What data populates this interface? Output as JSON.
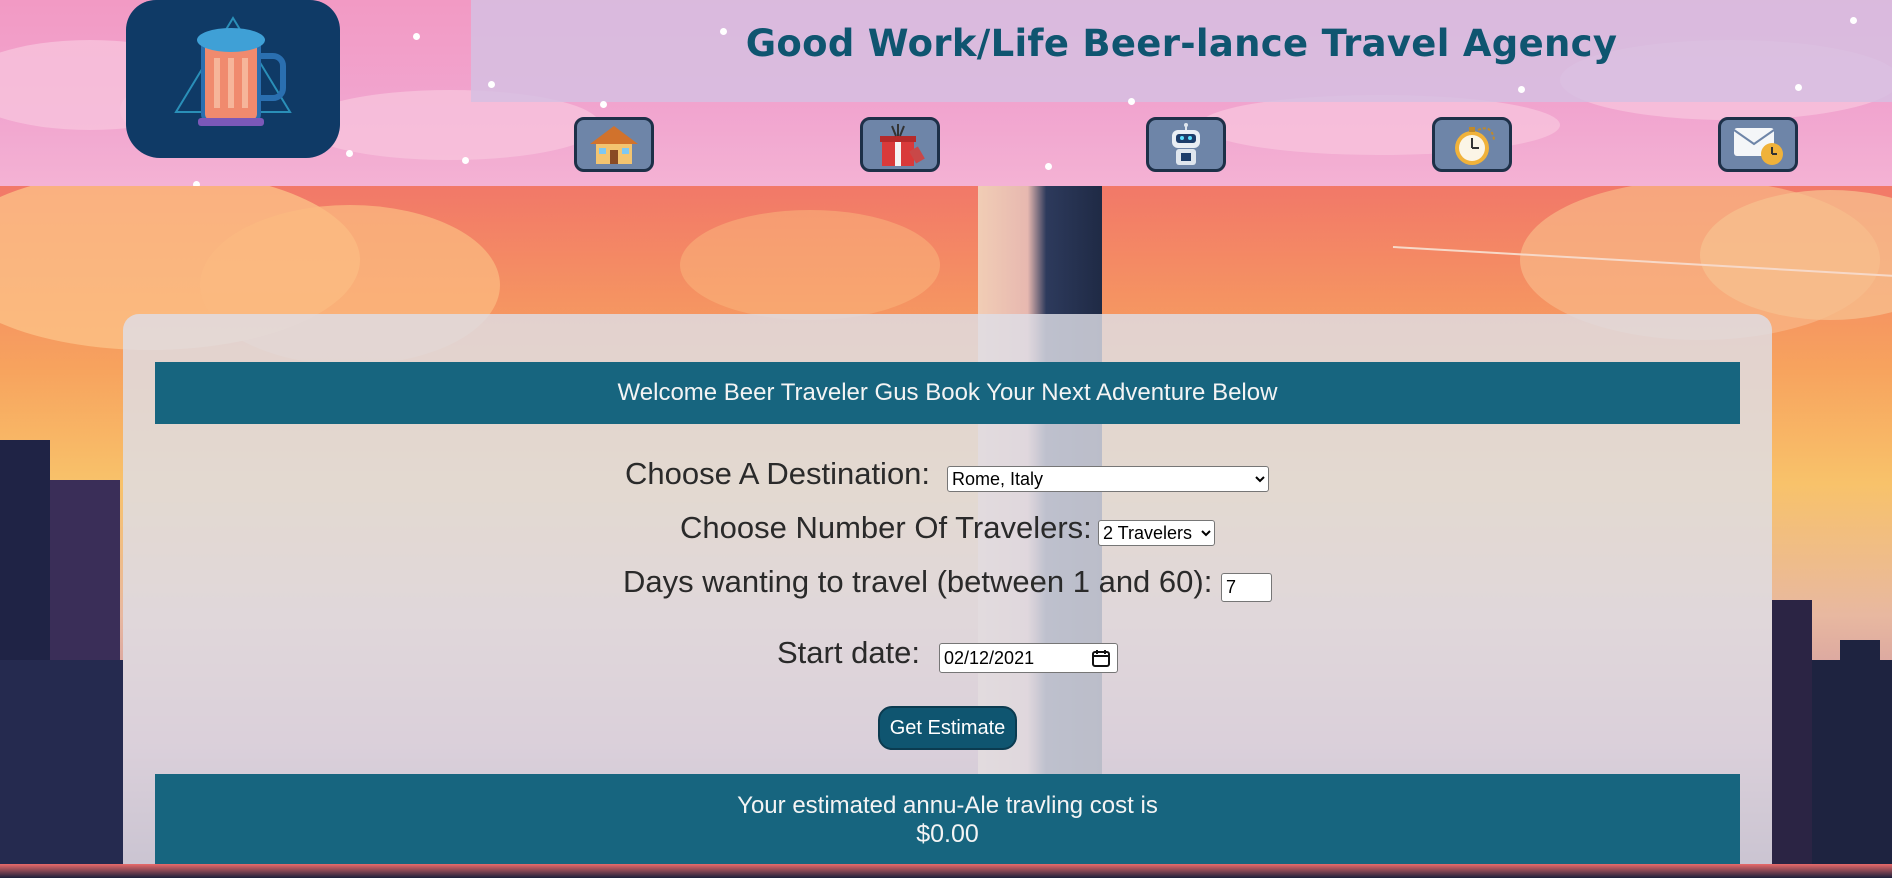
{
  "header": {
    "title": "Good Work/Life Beer-lance Travel Agency",
    "logo_icon": "beer-mug-icon",
    "nav": [
      {
        "icon": "home-icon",
        "label": "Home"
      },
      {
        "icon": "gift-icon",
        "label": "Gifts"
      },
      {
        "icon": "robot-icon",
        "label": "Robot"
      },
      {
        "icon": "stopwatch-icon",
        "label": "Timer"
      },
      {
        "icon": "mail-clock-icon",
        "label": "Contact"
      }
    ]
  },
  "welcome": {
    "text": "Welcome Beer Traveler Gus Book Your Next Adventure Below"
  },
  "form": {
    "destination_label": "Choose A Destination:",
    "destination_value": "Rome, Italy",
    "travelers_label": "Choose Number Of Travelers:",
    "travelers_value": "2 Travelers",
    "days_label": "Days wanting to travel (between 1 and 60):",
    "days_value": "7",
    "start_label": "Start date:",
    "start_value": "02/12/2021",
    "submit_label": "Get Estimate"
  },
  "result": {
    "text": "Your estimated annu-Ale travling cost is",
    "amount": "$0.00"
  },
  "colors": {
    "accent": "#17657f",
    "title": "#0f5570",
    "header_bg": "#f1a5cf"
  }
}
